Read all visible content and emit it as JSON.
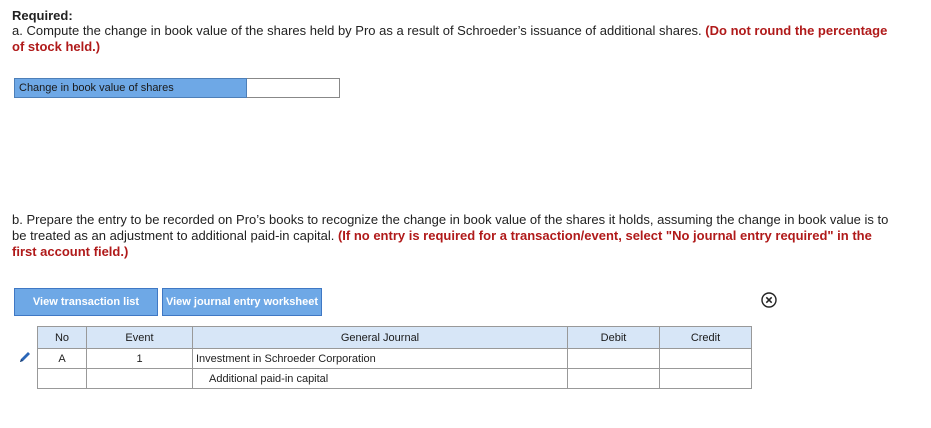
{
  "required_heading": "Required:",
  "part_a": {
    "text": "a. Compute the change in book value of the shares held by Pro as a result of Schroeder’s issuance of additional shares.",
    "note": "(Do not round the percentage of stock held.)",
    "row_label": "Change in book value of shares",
    "row_value": ""
  },
  "part_b": {
    "text": "b. Prepare the entry to be recorded on Pro’s books to recognize the change in book value of the shares it holds, assuming the change in book value is to be treated as an adjustment to additional paid-in capital.",
    "note": "(If no entry is required for a transaction/event, select \"No journal entry required\" in the first account field.)"
  },
  "buttons": {
    "view_transaction_list": "View transaction list",
    "view_journal_worksheet": "View journal entry worksheet"
  },
  "journal": {
    "headers": {
      "no": "No",
      "event": "Event",
      "general_journal": "General Journal",
      "debit": "Debit",
      "credit": "Credit"
    },
    "rows": [
      {
        "no": "A",
        "event": "1",
        "account": "Investment in Schroeder Corporation",
        "debit": "",
        "credit": ""
      },
      {
        "no": "",
        "event": "",
        "account": "Additional paid-in capital",
        "debit": "",
        "credit": ""
      }
    ]
  },
  "colors": {
    "accent": "#6ea8e6",
    "note_red": "#b01a1a",
    "header_bg": "#d7e6f7"
  }
}
